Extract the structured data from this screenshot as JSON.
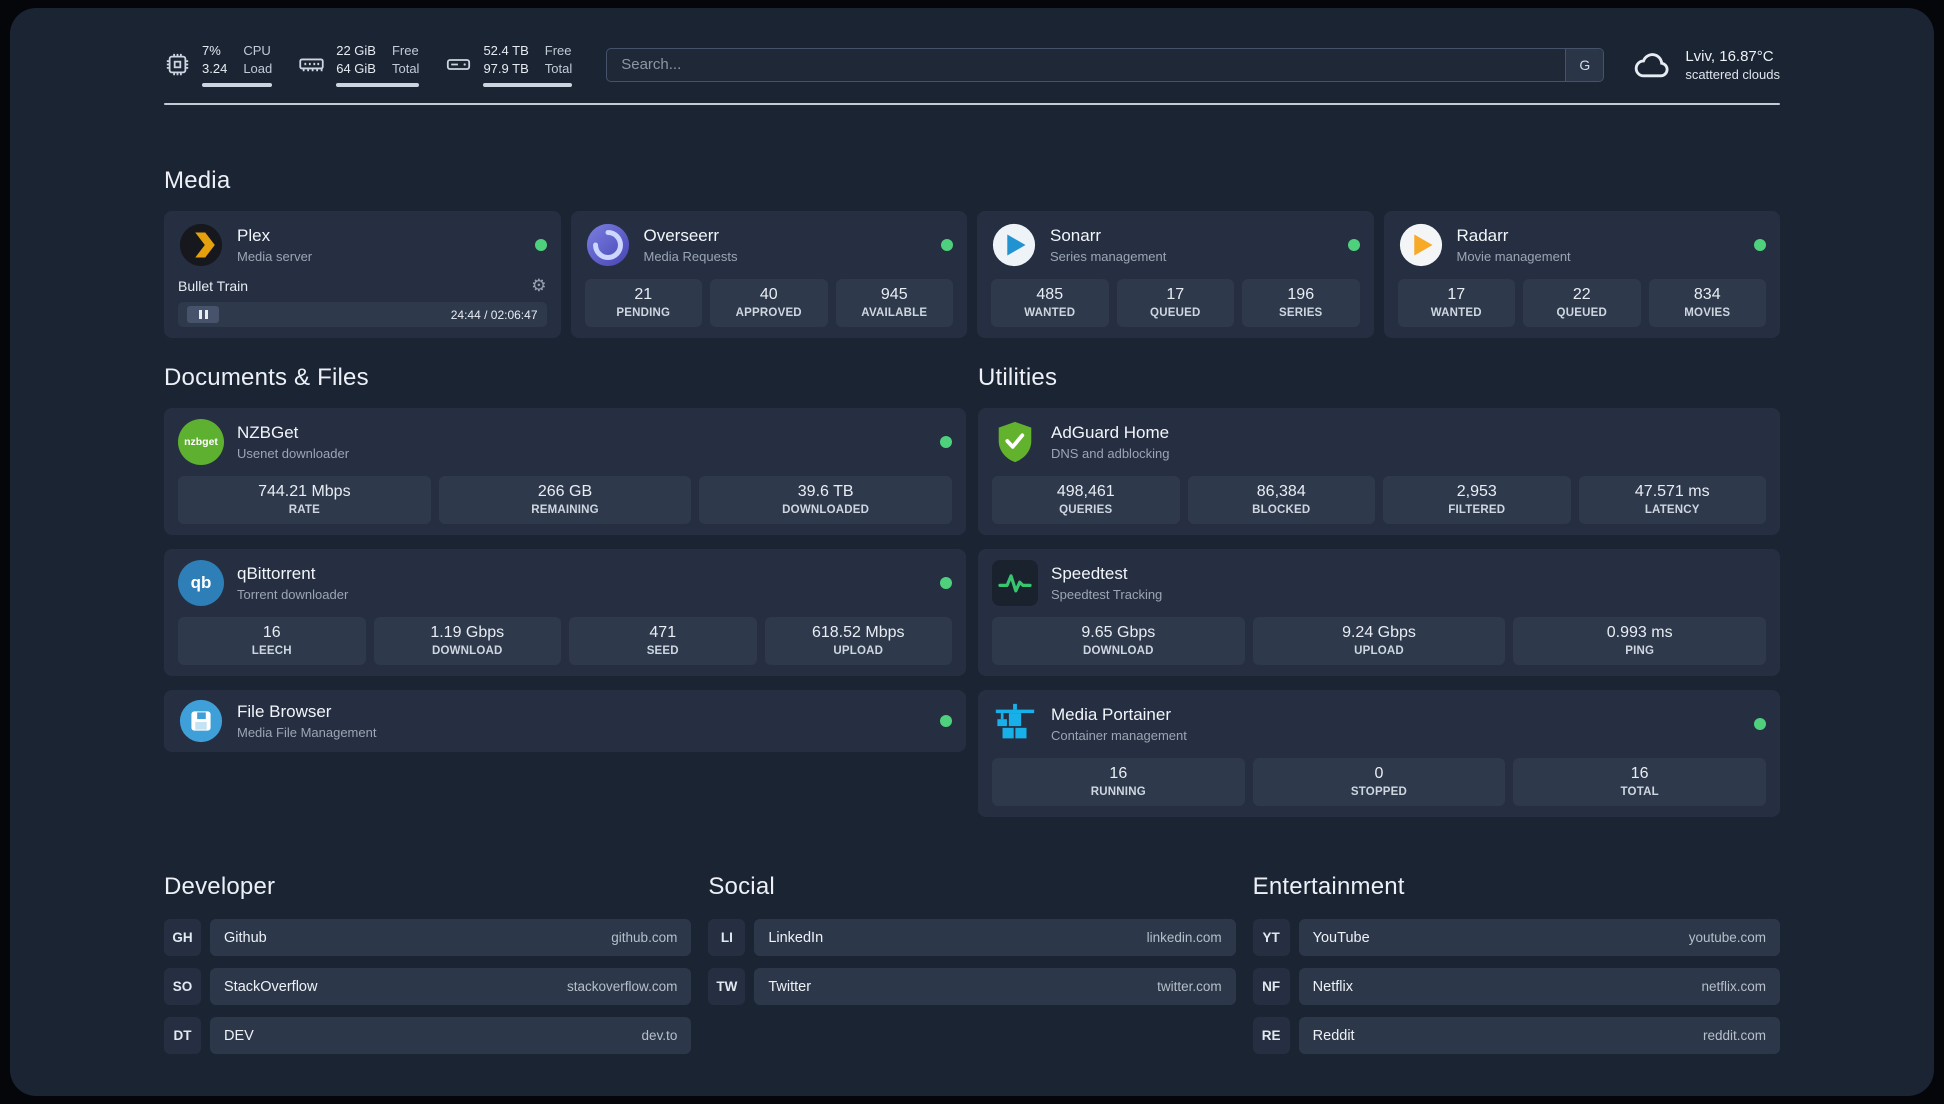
{
  "header": {
    "cpu": {
      "value1": "7%",
      "value2": "3.24",
      "label1": "CPU",
      "label2": "Load"
    },
    "ram": {
      "value1": "22 GiB",
      "value2": "64 GiB",
      "label1": "Free",
      "label2": "Total"
    },
    "disk": {
      "value1": "52.4 TB",
      "value2": "97.9 TB",
      "label1": "Free",
      "label2": "Total"
    },
    "search": {
      "placeholder": "Search...",
      "button_label": "G"
    },
    "weather": {
      "location": "Lviv, 16.87°C",
      "condition": "scattered clouds"
    }
  },
  "media": {
    "heading": "Media",
    "plex": {
      "title": "Plex",
      "subtitle": "Media server",
      "now_playing": "Bullet Train",
      "time": "24:44 / 02:06:47"
    },
    "overseerr": {
      "title": "Overseerr",
      "subtitle": "Media Requests",
      "stats": [
        {
          "value": "21",
          "label": "PENDING"
        },
        {
          "value": "40",
          "label": "APPROVED"
        },
        {
          "value": "945",
          "label": "AVAILABLE"
        }
      ]
    },
    "sonarr": {
      "title": "Sonarr",
      "subtitle": "Series management",
      "stats": [
        {
          "value": "485",
          "label": "WANTED"
        },
        {
          "value": "17",
          "label": "QUEUED"
        },
        {
          "value": "196",
          "label": "SERIES"
        }
      ]
    },
    "radarr": {
      "title": "Radarr",
      "subtitle": "Movie management",
      "stats": [
        {
          "value": "17",
          "label": "WANTED"
        },
        {
          "value": "22",
          "label": "QUEUED"
        },
        {
          "value": "834",
          "label": "MOVIES"
        }
      ]
    }
  },
  "documents": {
    "heading": "Documents & Files",
    "nzbget": {
      "title": "NZBGet",
      "subtitle": "Usenet downloader",
      "stats": [
        {
          "value": "744.21 Mbps",
          "label": "RATE"
        },
        {
          "value": "266 GB",
          "label": "REMAINING"
        },
        {
          "value": "39.6 TB",
          "label": "DOWNLOADED"
        }
      ]
    },
    "qbittorrent": {
      "title": "qBittorrent",
      "subtitle": "Torrent downloader",
      "stats": [
        {
          "value": "16",
          "label": "LEECH"
        },
        {
          "value": "1.19 Gbps",
          "label": "DOWNLOAD"
        },
        {
          "value": "471",
          "label": "SEED"
        },
        {
          "value": "618.52 Mbps",
          "label": "UPLOAD"
        }
      ]
    },
    "filebrowser": {
      "title": "File Browser",
      "subtitle": "Media File Management"
    }
  },
  "utilities": {
    "heading": "Utilities",
    "adguard": {
      "title": "AdGuard Home",
      "subtitle": "DNS and adblocking",
      "stats": [
        {
          "value": "498,461",
          "label": "QUERIES"
        },
        {
          "value": "86,384",
          "label": "BLOCKED"
        },
        {
          "value": "2,953",
          "label": "FILTERED"
        },
        {
          "value": "47.571 ms",
          "label": "LATENCY"
        }
      ]
    },
    "speedtest": {
      "title": "Speedtest",
      "subtitle": "Speedtest Tracking",
      "stats": [
        {
          "value": "9.65 Gbps",
          "label": "DOWNLOAD"
        },
        {
          "value": "9.24 Gbps",
          "label": "UPLOAD"
        },
        {
          "value": "0.993 ms",
          "label": "PING"
        }
      ]
    },
    "portainer": {
      "title": "Media Portainer",
      "subtitle": "Container management",
      "stats": [
        {
          "value": "16",
          "label": "RUNNING"
        },
        {
          "value": "0",
          "label": "STOPPED"
        },
        {
          "value": "16",
          "label": "TOTAL"
        }
      ]
    }
  },
  "links": {
    "developer": {
      "heading": "Developer",
      "items": [
        {
          "badge": "GH",
          "name": "Github",
          "url": "github.com"
        },
        {
          "badge": "SO",
          "name": "StackOverflow",
          "url": "stackoverflow.com"
        },
        {
          "badge": "DT",
          "name": "DEV",
          "url": "dev.to"
        }
      ]
    },
    "social": {
      "heading": "Social",
      "items": [
        {
          "badge": "LI",
          "name": "LinkedIn",
          "url": "linkedin.com"
        },
        {
          "badge": "TW",
          "name": "Twitter",
          "url": "twitter.com"
        }
      ]
    },
    "entertainment": {
      "heading": "Entertainment",
      "items": [
        {
          "badge": "YT",
          "name": "YouTube",
          "url": "youtube.com"
        },
        {
          "badge": "NF",
          "name": "Netflix",
          "url": "netflix.com"
        },
        {
          "badge": "RE",
          "name": "Reddit",
          "url": "reddit.com"
        }
      ]
    }
  },
  "icons": {
    "gear": "⚙",
    "nzbget_logo_text": "nzbget",
    "qbittorrent_logo_text": "qb"
  },
  "colors": {
    "background": "#1b2433",
    "card": "#252f41",
    "tile": "#2e394c",
    "status_green": "#4ed07d",
    "plex_gold": "#e5a00d",
    "adguard_green": "#63b22e",
    "portainer_blue": "#18b0e8"
  }
}
